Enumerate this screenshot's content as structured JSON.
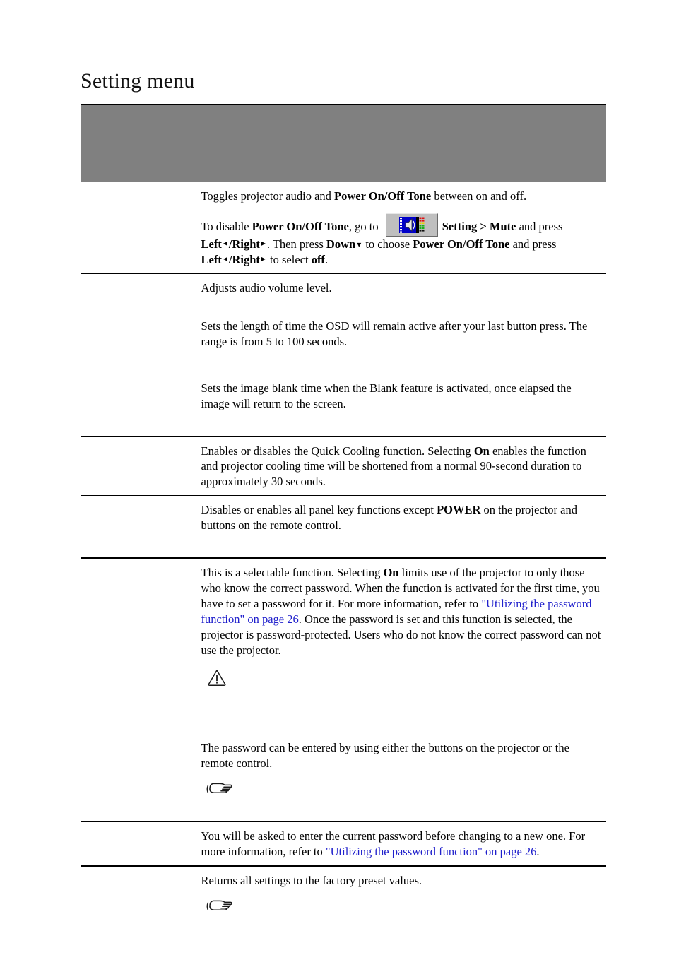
{
  "page": {
    "title": "Setting menu"
  },
  "table": {
    "header": {
      "function_column": "",
      "description_column": ""
    },
    "rows": [
      {
        "function": "",
        "paragraphs": [
          {
            "kind": "rich",
            "segments": [
              {
                "text": "Toggles projector audio and ",
                "style": "normal"
              },
              {
                "text": "Power On/Off Tone",
                "style": "bold"
              },
              {
                "text": " between on and off.",
                "style": "normal"
              }
            ]
          },
          {
            "kind": "rich-icon",
            "segments": [
              {
                "text": "To disable ",
                "style": "normal"
              },
              {
                "text": "Power On/Off Tone",
                "style": "bold"
              },
              {
                "text": ", go to ",
                "style": "normal"
              },
              {
                "text": "audio-mute-icon",
                "style": "icon"
              },
              {
                "text": "Setting > Mute",
                "style": "bold"
              },
              {
                "text": " and press ",
                "style": "normal"
              },
              {
                "text": "Left",
                "style": "bold"
              },
              {
                "text": "◂",
                "style": "arrow"
              },
              {
                "text": "/Right",
                "style": "bold"
              },
              {
                "text": "▸",
                "style": "arrow"
              },
              {
                "text": ". Then press ",
                "style": "normal"
              },
              {
                "text": "Down",
                "style": "bold"
              },
              {
                "text": "▾",
                "style": "arrow"
              },
              {
                "text": " to choose ",
                "style": "normal"
              },
              {
                "text": "Power On/Off Tone",
                "style": "bold"
              },
              {
                "text": " and press ",
                "style": "normal"
              },
              {
                "text": "Left",
                "style": "bold"
              },
              {
                "text": "◂",
                "style": "arrow"
              },
              {
                "text": "/Right",
                "style": "bold"
              },
              {
                "text": "▸",
                "style": "arrow"
              },
              {
                "text": " to  select ",
                "style": "normal"
              },
              {
                "text": "off",
                "style": "bold"
              },
              {
                "text": ".",
                "style": "normal"
              }
            ]
          }
        ]
      },
      {
        "function": "",
        "text": "Adjusts audio volume level."
      },
      {
        "function": "",
        "text": "Sets the length of time the OSD will remain active after your last button press. The range is from 5 to 100 seconds."
      },
      {
        "function": "",
        "text": "Sets the image blank time when the Blank feature is activated, once elapsed the image will return to the screen."
      },
      {
        "function": "",
        "text_a": "Enables or disables the Quick Cooling function. Selecting ",
        "bold_a": "On",
        "text_b": " enables the function and projector cooling time will be shortened from a normal 90-second duration to approximately 30 seconds."
      },
      {
        "function": "",
        "text_a": "Disables or enables all panel key functions except ",
        "bold_a": "POWER",
        "text_b": " on the projector and buttons on the remote control."
      },
      {
        "function": "",
        "p1_a": "This is a selectable function. Selecting ",
        "p1_bold": "On",
        "p1_b": " limits use of the projector to only those who know the correct password. When the function is activated for the first time, you have to set a password for it. For more information, refer to ",
        "p1_link": "\"Utilizing the password function\" on page 26",
        "p1_c": ". Once the password is set and this function is selected, the projector is password-protected. Users who do not know the correct password can not use the projector.",
        "warn_icon": "warning-triangle-icon",
        "warn_note": "",
        "p2": "The password can be entered by using either the buttons on the projector or the remote control.",
        "hand_icon": "pointing-hand-icon",
        "hand_note": ""
      },
      {
        "function": "",
        "p1_a": "You will be asked to enter the current password before changing to a new one. For more information, refer to ",
        "p1_link": "\"Utilizing the password function\" on page 26",
        "p1_c": "."
      },
      {
        "function": "",
        "p1": "Returns all settings to the factory preset values.",
        "hand_icon": "pointing-hand-icon",
        "hand_note": ""
      }
    ]
  },
  "colors": {
    "header_gray": "#808080",
    "link_blue": "#2020cc",
    "text_black": "#000000"
  }
}
